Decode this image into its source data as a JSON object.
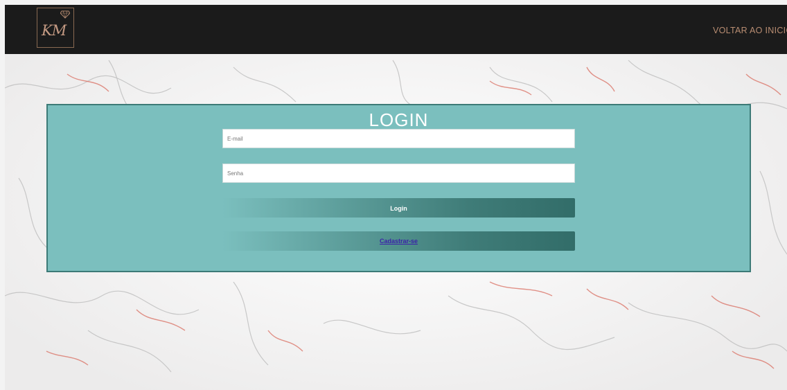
{
  "header": {
    "logo_text": "KM",
    "nav_link_label": "VOLTAR AO INICIO"
  },
  "login": {
    "title": "LOGIN",
    "email_placeholder": "E-mail",
    "password_placeholder": "Senha",
    "login_button_label": "Login",
    "signup_link_label": "Cadastrar-se"
  },
  "colors": {
    "navbar": "#1b1b1b",
    "accent_gold": "#b88d72",
    "panel": "#7bbfbe",
    "panel_border": "#3c7a77",
    "button_dark": "#326d69",
    "link": "#3b22a8"
  },
  "icons": {
    "logo_gem": "diamond-icon"
  }
}
